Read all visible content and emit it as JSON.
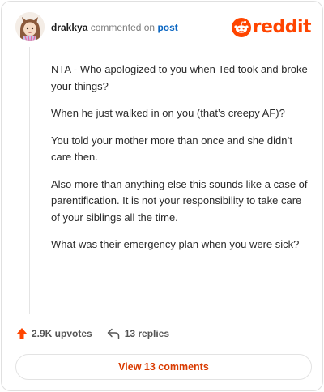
{
  "comment": {
    "username": "drakkya",
    "action_text": "commented on",
    "post_link": "post",
    "paragraphs": [
      "NTA - Who apologized to you when Ted took and broke your things?",
      "When he just walked in on you (that’s creepy AF)?",
      "You told your mother more than once and she didn’t care then.",
      "Also more than anything else this sounds like a case of parentification. It is not your responsibility to take care of your siblings all the time.",
      "What was their emergency plan when you were sick?"
    ]
  },
  "brand": {
    "wordmark": "reddit",
    "color": "#ff4500"
  },
  "actions": {
    "upvotes": "2.9K upvotes",
    "replies": "13 replies"
  },
  "view_button": "View 13 comments",
  "icons": {
    "brand": "reddit-logo-icon",
    "upvote": "upvote-arrow-icon",
    "reply": "reply-arrow-icon"
  },
  "colors": {
    "upvote": "#ff4500",
    "link": "#0a66c2",
    "button_text": "#d93a00"
  }
}
